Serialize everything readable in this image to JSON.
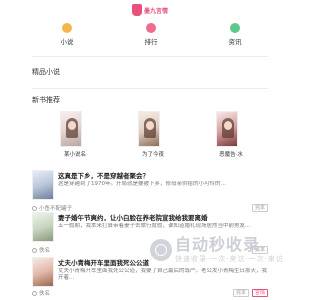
{
  "header": {
    "logo_text": "墨九言情"
  },
  "nav": [
    {
      "label": "小说",
      "icon": "book-icon",
      "color": "#f5b54a"
    },
    {
      "label": "排行",
      "icon": "ranking-icon",
      "color": "#f06b8d"
    },
    {
      "label": "资讯",
      "icon": "news-icon",
      "color": "#5cc98a"
    }
  ],
  "sections": {
    "jingpin": "精品小说",
    "xinshu": "新书推荐"
  },
  "covers": [
    {
      "title": "某小说名"
    },
    {
      "title": "为了今夜"
    },
    {
      "title": "恶魔告·水"
    }
  ],
  "books": [
    {
      "title": "这真是下乡，不是穿越者聚会？",
      "desc": "这是穿越到了1970年。开局就是要被下乡，修母亲供给的小可怜的…",
      "author": "小鱼不配罐子",
      "tags": [
        "完本"
      ]
    },
    {
      "title": "妻子婚午节爽约，让小白脸在养老院宣我给我要离婚",
      "desc": "五一假期，我本来打算带着妻子去旅行度假，谁知道婚礼现场居然当中前男友…",
      "author": "佚名",
      "tags": [
        "完本"
      ]
    },
    {
      "title": "丈夫小青梅开车里面我死公公道",
      "desc": "丈夫小青梅开车里面我死公公道，我要了自己最后的尊严。老公发小青梅生日那天，我开着…",
      "author": "佚名",
      "tags": [
        "完本",
        "言情"
      ]
    }
  ],
  "watermark": {
    "title": "自动秒收录",
    "subtitle": "快速收录·一次·来访·一次·来访"
  }
}
